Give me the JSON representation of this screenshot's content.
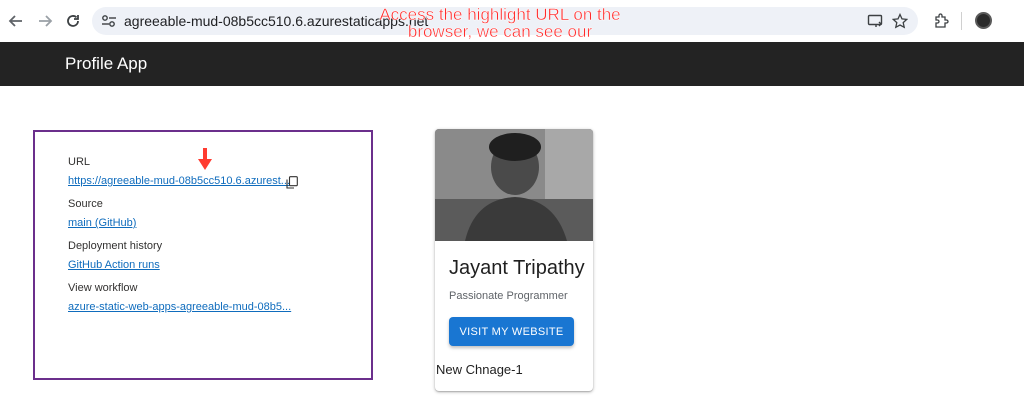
{
  "browser": {
    "url": "agreeable-mud-08b5cc510.6.azurestaticapps.net",
    "icons": [
      "back-icon",
      "forward-icon",
      "reload-icon",
      "site-info-icon",
      "cast-icon",
      "bookmark-star-icon",
      "extensions-icon",
      "profile-avatar"
    ]
  },
  "annotation": {
    "text": "Access the highlight URL on the browser, we can see our application is now accessible",
    "color": "#ff2b2b"
  },
  "app": {
    "title": "Profile App"
  },
  "azure_panel": {
    "border_color": "#6b2f8c",
    "url_label": "URL",
    "url_value": "https://agreeable-mud-08b5cc510.6.azurest...",
    "source_label": "Source",
    "source_value": "main (GitHub)",
    "history_label": "Deployment history",
    "history_value": "GitHub Action runs",
    "workflow_label": "View workflow",
    "workflow_value": "azure-static-web-apps-agreeable-mud-08b5..."
  },
  "profile_card": {
    "name": "Jayant Tripathy",
    "subtitle": "Passionate Programmer",
    "button_label": "VISIT MY WEBSITE",
    "footer_text": "New Chnage-1",
    "button_color": "#1976d2"
  }
}
